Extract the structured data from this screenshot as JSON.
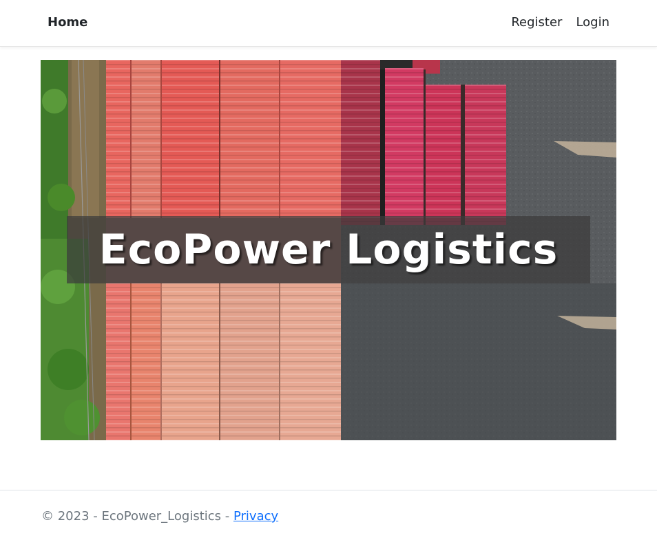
{
  "navbar": {
    "brand": "Home",
    "links": [
      {
        "label": "Register"
      },
      {
        "label": "Login"
      }
    ]
  },
  "hero": {
    "title": "EcoPower Logistics"
  },
  "footer": {
    "copyright": "© 2023 - EcoPower_Logistics - ",
    "privacy_label": "Privacy"
  },
  "colors": {
    "link": "#0d6efd",
    "muted_text": "#6c757d",
    "container_red": "#e8665f",
    "container_pink": "#c8385a",
    "container_tan": "#e8a48c",
    "concrete": "#5b5e60",
    "foliage": "#4e8a32"
  }
}
